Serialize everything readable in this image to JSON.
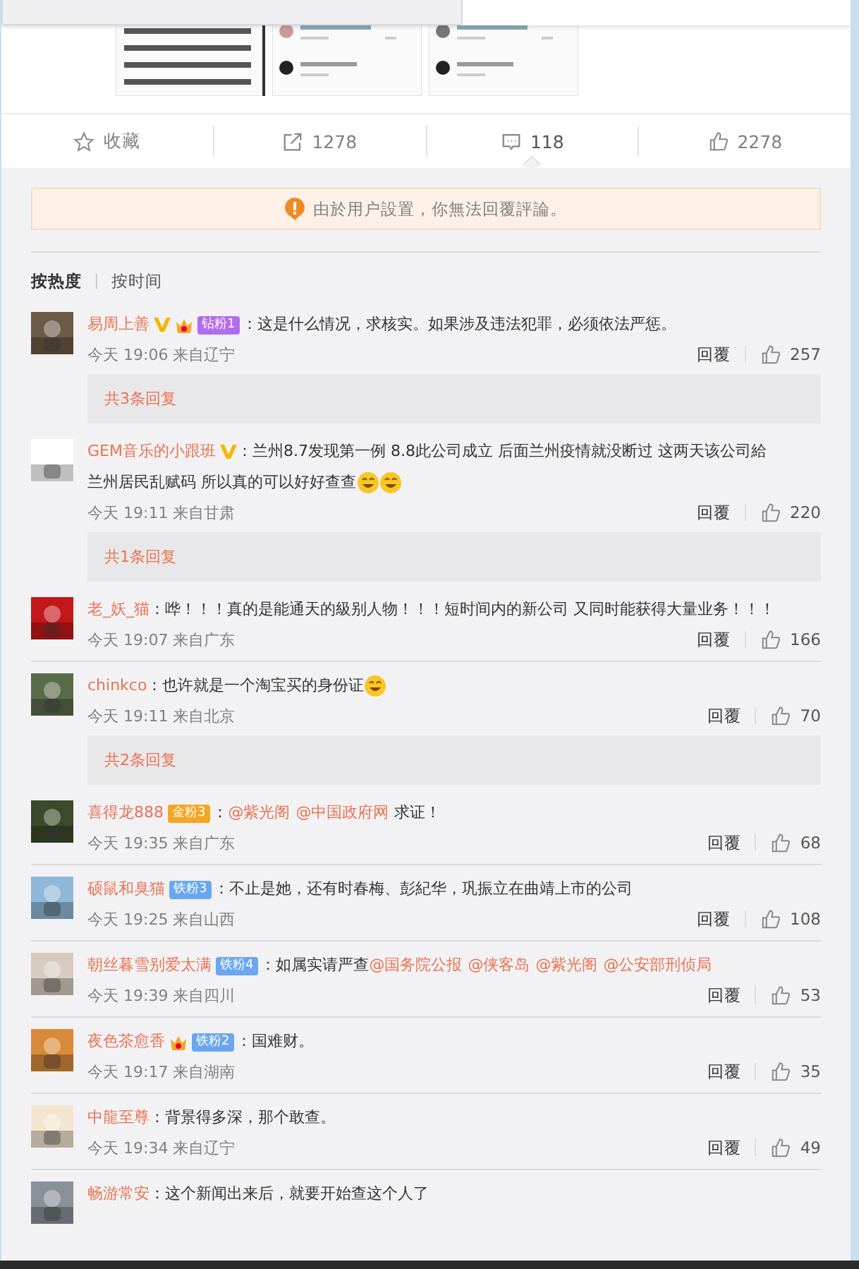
{
  "action_bar": [
    {
      "kind": "star",
      "label": "收藏",
      "selected": false
    },
    {
      "kind": "share",
      "label": "1278",
      "selected": false
    },
    {
      "kind": "comment",
      "label": "118",
      "selected": true
    },
    {
      "kind": "like",
      "label": "2278",
      "selected": false
    }
  ],
  "notice": "由於用户設置，你無法回覆評論。",
  "sort_tabs": [
    {
      "label": "按热度",
      "selected": true
    },
    {
      "label": "按时间",
      "selected": false
    }
  ],
  "comments": [
    {
      "name": "易周上善",
      "verified": true,
      "crown": true,
      "badge": {
        "text": "钻粉1",
        "color": "#b26cf0"
      },
      "body": [
        {
          "kind": "text",
          "text": "：这是什么情况，求核实。如果涉及违法犯罪，必须依法严惩。"
        }
      ],
      "time": "今天 19:06 来自辽宁",
      "reply": "回覆",
      "likes": "257",
      "replies": "共3条回复"
    },
    {
      "name": "GEM音乐的小跟班",
      "verified": true,
      "crown": false,
      "body": [
        {
          "kind": "text",
          "text": "：兰州8.7发现第一例 8.8此公司成立 后面兰州疫情就没断过 这两天该公司給"
        },
        {
          "kind": "text",
          "text": "兰州居民乱赋码 所以真的可以好好查查"
        },
        {
          "kind": "emoji"
        },
        {
          "kind": "emoji"
        }
      ],
      "time": "今天 19:11 来自甘肃",
      "reply": "回覆",
      "likes": "220",
      "replies": "共1条回复"
    },
    {
      "name": "老_妖_猫",
      "verified": false,
      "crown": false,
      "body": [
        {
          "kind": "text",
          "text": "：哗！！！真的是能通天的級别人物！！！短时间内的新公司 又同时能获得大量业"
        },
        {
          "kind": "text",
          "text": "务！！！"
        }
      ],
      "time": "今天 19:07 来自广东",
      "reply": "回覆",
      "likes": "166"
    },
    {
      "name": "chinkco",
      "verified": false,
      "crown": false,
      "body": [
        {
          "kind": "text",
          "text": "：也许就是一个淘宝买的身份证"
        },
        {
          "kind": "emoji"
        }
      ],
      "time": "今天 19:11 来自北京",
      "reply": "回覆",
      "likes": "70",
      "replies": "共2条回复"
    },
    {
      "name": "喜得龙888",
      "verified": false,
      "crown": false,
      "badge": {
        "text": "金粉3",
        "color": "#f5a623"
      },
      "body": [
        {
          "kind": "text",
          "text": "："
        },
        {
          "kind": "mention",
          "text": "@紫光阁"
        },
        {
          "kind": "mention",
          "text": "@中国政府网"
        },
        {
          "kind": "text",
          "text": "求证！"
        }
      ],
      "time": "今天 19:35 来自广东",
      "reply": "回覆",
      "likes": "68"
    },
    {
      "name": "硕鼠和臭猫",
      "verified": false,
      "crown": false,
      "badge": {
        "text": "铁粉3",
        "color": "#6aa7f0"
      },
      "body": [
        {
          "kind": "text",
          "text": "：不止是她，还有时春梅、彭紀华，巩振立在曲靖上市的公司"
        }
      ],
      "time": "今天 19:25 来自山西",
      "reply": "回覆",
      "likes": "108"
    },
    {
      "name": "朝丝暮雪别爱太满",
      "verified": false,
      "crown": false,
      "badge": {
        "text": "铁粉4",
        "color": "#6aa7f0"
      },
      "body": [
        {
          "kind": "text",
          "text": "：如属实请严查"
        },
        {
          "kind": "mention",
          "text": "@国务院公报"
        },
        {
          "kind": "mention",
          "text": "@侠客岛"
        },
        {
          "kind": "mention",
          "text": "@紫光阁"
        },
        {
          "kind": "mention",
          "text": "@公安部刑侦局"
        }
      ],
      "time": "今天 19:39 来自四川",
      "reply": "回覆",
      "likes": "53"
    },
    {
      "name": "夜色茶愈香",
      "verified": false,
      "crown": true,
      "badge": {
        "text": "铁粉2",
        "color": "#6aa7f0"
      },
      "body": [
        {
          "kind": "text",
          "text": "：国难财。"
        }
      ],
      "time": "今天 19:17 来自湖南",
      "reply": "回覆",
      "likes": "35"
    },
    {
      "name": "中龍至尊",
      "verified": false,
      "crown": false,
      "body": [
        {
          "kind": "text",
          "text": "：背景得多深，那个敢查。"
        }
      ],
      "time": "今天 19:34 来自辽宁",
      "reply": "回覆",
      "likes": "49"
    },
    {
      "name": "畅游常安",
      "verified": false,
      "crown": false,
      "body": [
        {
          "kind": "text",
          "text": "：这个新闻出来后，就要开始查这个人了"
        }
      ]
    }
  ]
}
